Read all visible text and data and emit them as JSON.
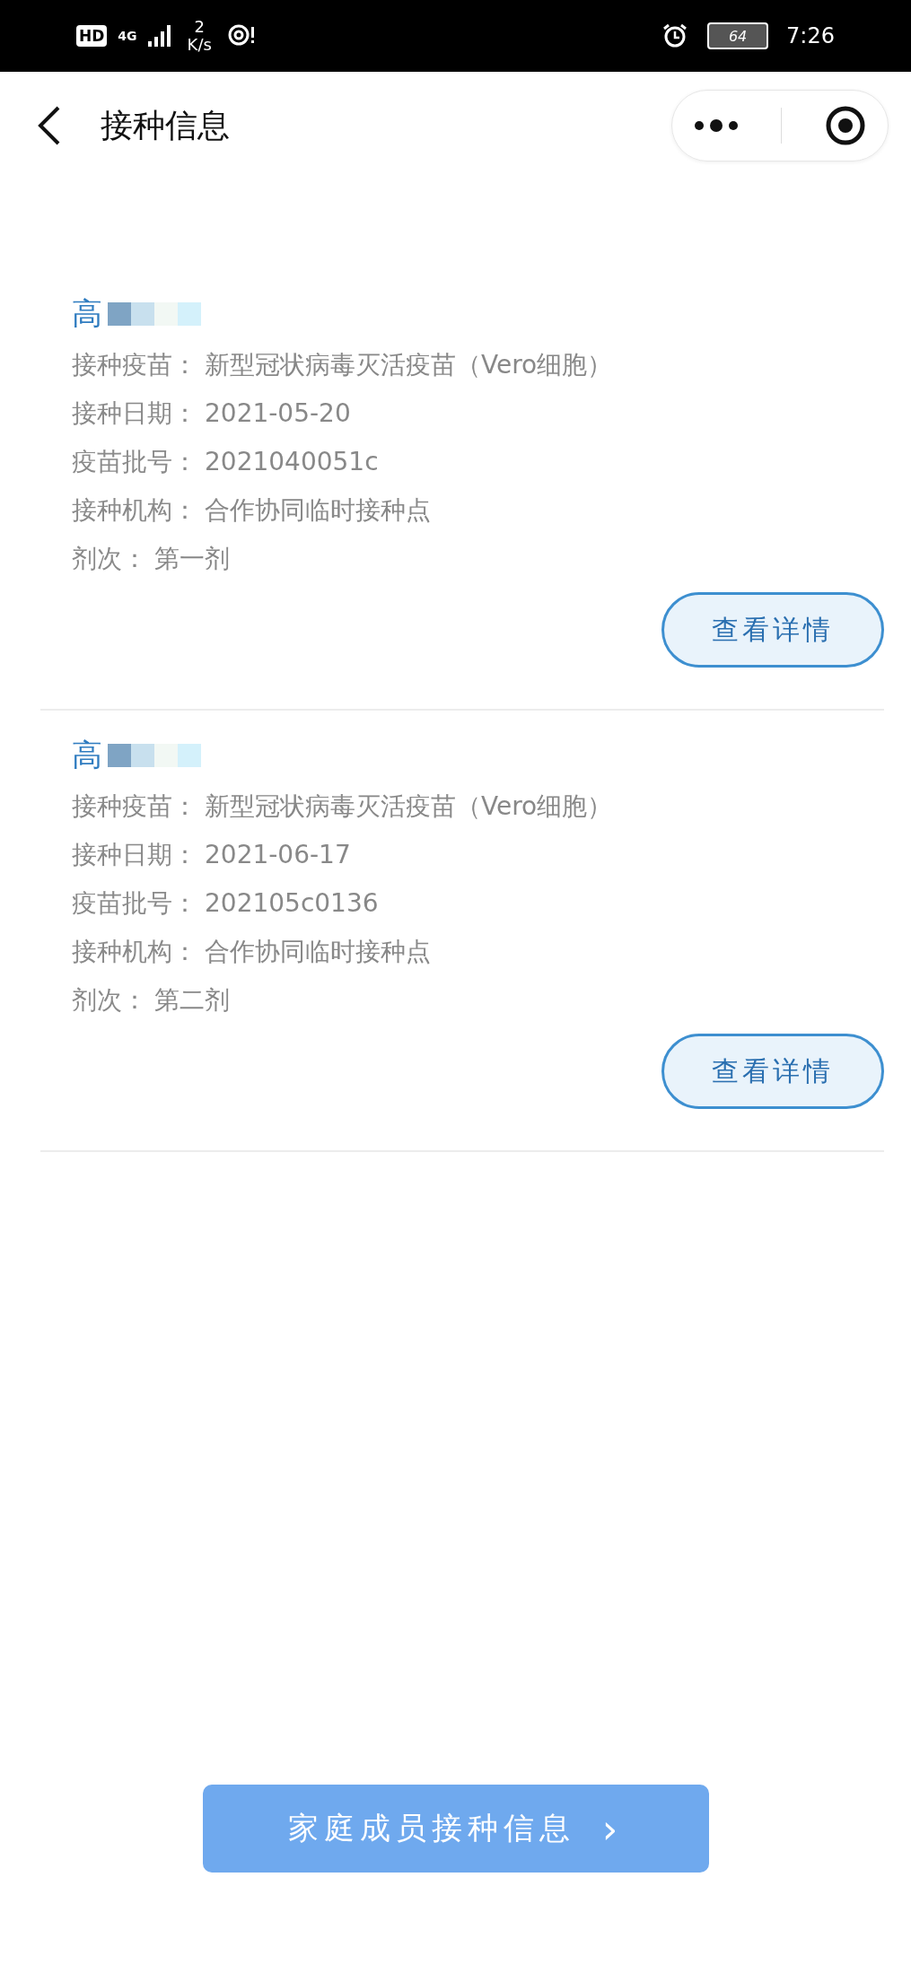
{
  "status_bar": {
    "hd": "HD",
    "network": "4G",
    "speed_value": "2",
    "speed_unit": "K/s",
    "battery": "64",
    "time": "7:26"
  },
  "header": {
    "title": "接种信息"
  },
  "records": [
    {
      "name": "高",
      "fields": [
        {
          "label": "接种疫苗：",
          "value": "新型冠状病毒灭活疫苗（Vero细胞）"
        },
        {
          "label": "接种日期：",
          "value": "2021-05-20"
        },
        {
          "label": "疫苗批号：",
          "value": "2021040051c"
        },
        {
          "label": "接种机构：",
          "value": "合作协同临时接种点"
        },
        {
          "label": "剂次：",
          "value": "第一剂"
        }
      ],
      "button": "查看详情"
    },
    {
      "name": "高",
      "fields": [
        {
          "label": "接种疫苗：",
          "value": "新型冠状病毒灭活疫苗（Vero细胞）"
        },
        {
          "label": "接种日期：",
          "value": "2021-06-17"
        },
        {
          "label": "疫苗批号：",
          "value": "202105c0136"
        },
        {
          "label": "接种机构：",
          "value": "合作协同临时接种点"
        },
        {
          "label": "剂次：",
          "value": "第二剂"
        }
      ],
      "button": "查看详情"
    }
  ],
  "family_button": {
    "label": "家庭成员接种信息",
    "arrow": "›"
  }
}
